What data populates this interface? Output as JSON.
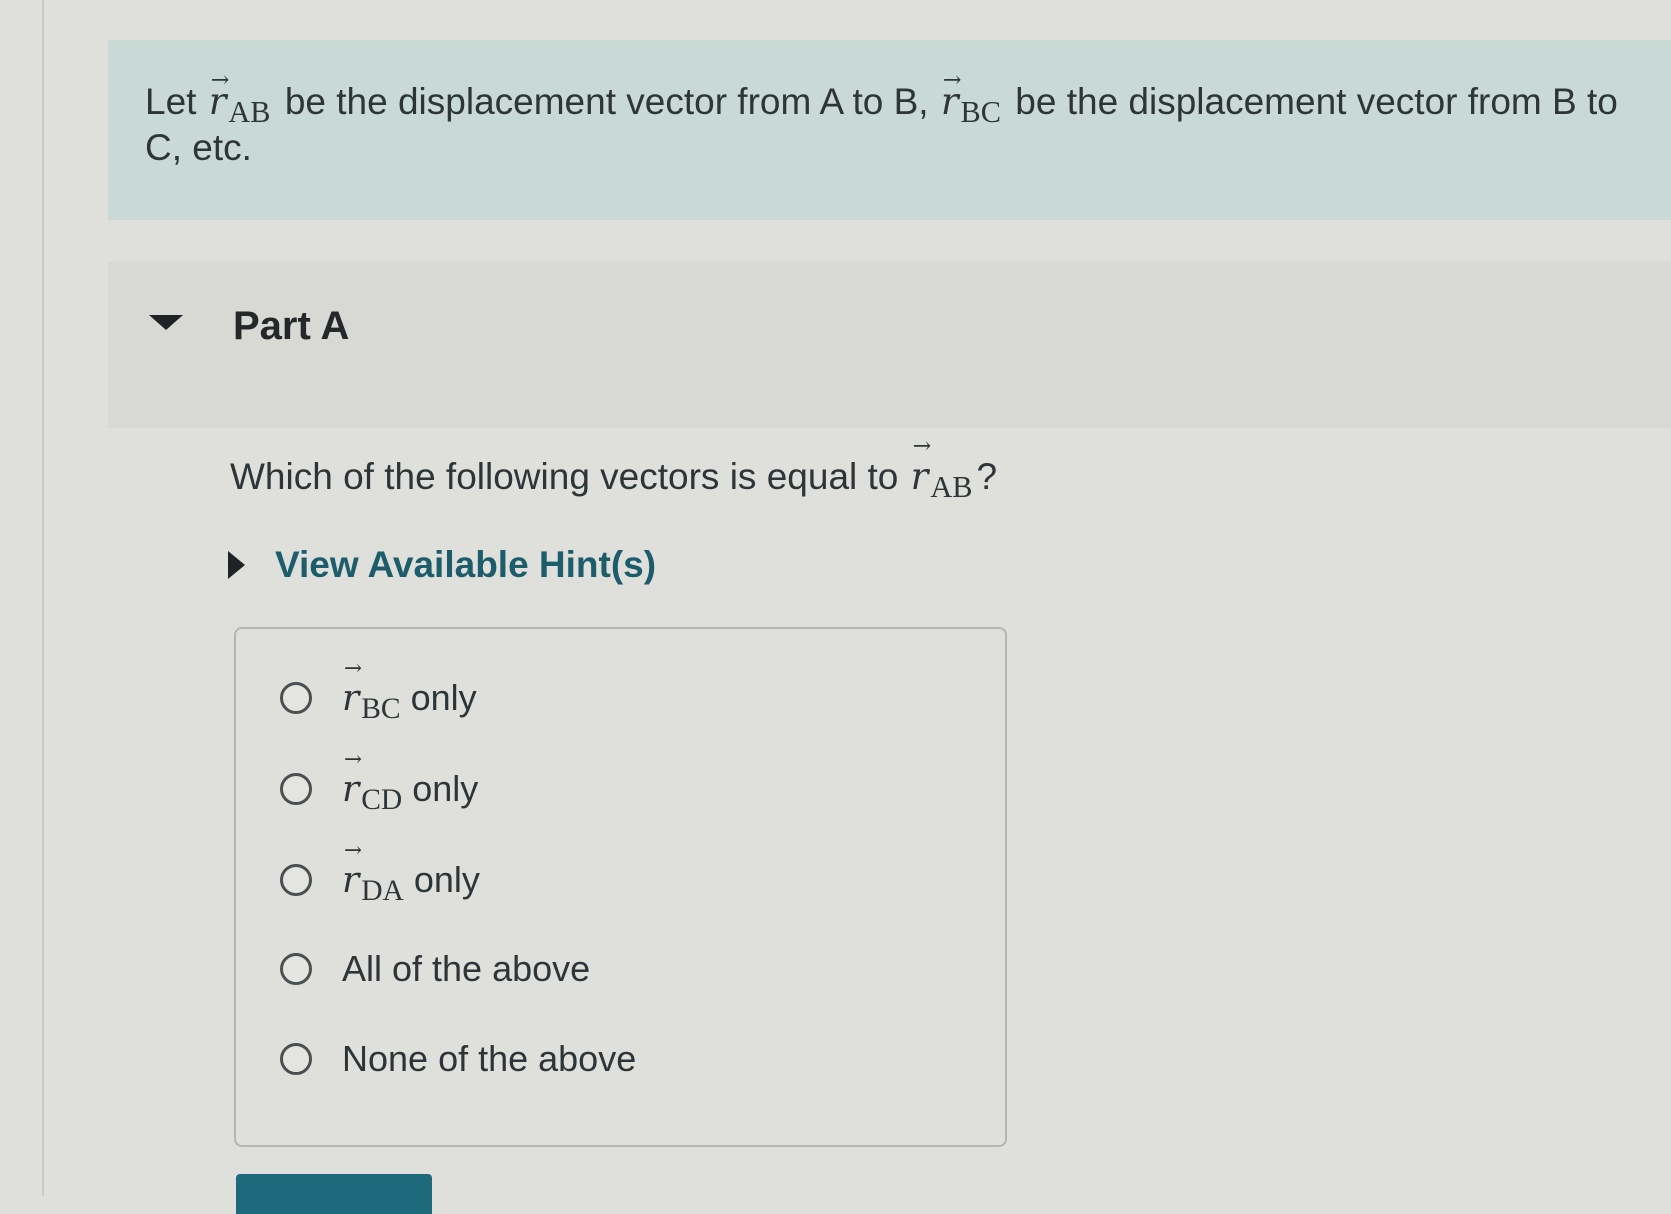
{
  "intro": {
    "let": "Let",
    "r": "r",
    "sub_ab": "AB",
    "text_1": "be the displacement vector from A to B,",
    "sub_bc": "BC",
    "text_2": "be the displacement vector from B to C, etc."
  },
  "part": {
    "title": "Part A"
  },
  "question": {
    "text": "Which of the following vectors is equal to",
    "r": "r",
    "sub": "AB",
    "end": "?"
  },
  "hint": {
    "label": "View Available Hint(s)"
  },
  "options": [
    {
      "r": "r",
      "sub": "BC",
      "text": "only"
    },
    {
      "r": "r",
      "sub": "CD",
      "text": "only"
    },
    {
      "r": "r",
      "sub": "DA",
      "text": "only"
    },
    {
      "text": "All of the above"
    },
    {
      "text": "None of the above"
    }
  ]
}
